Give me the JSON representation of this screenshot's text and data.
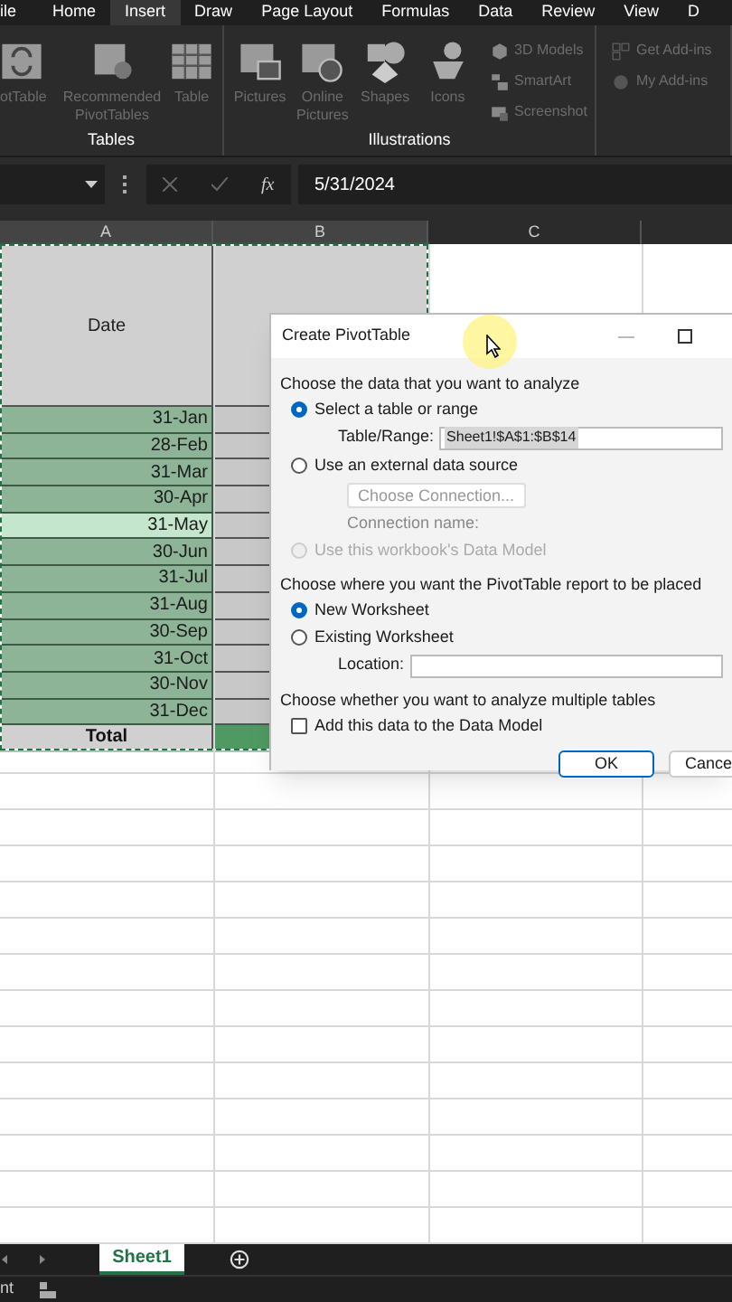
{
  "ribbon_tabs": [
    {
      "label": "ile",
      "selected": false
    },
    {
      "label": "Home",
      "selected": false
    },
    {
      "label": "Insert",
      "selected": true
    },
    {
      "label": "Draw",
      "selected": false
    },
    {
      "label": "Page Layout",
      "selected": false
    },
    {
      "label": "Formulas",
      "selected": false
    },
    {
      "label": "Data",
      "selected": false
    },
    {
      "label": "Review",
      "selected": false
    },
    {
      "label": "View",
      "selected": false
    },
    {
      "label": "D",
      "selected": false
    }
  ],
  "ribbon_groups": [
    {
      "label": "Tables",
      "commands": [
        {
          "label": "otTable",
          "kind": "pivot"
        },
        {
          "label": "Recommended PivotTables",
          "kind": "recommended"
        },
        {
          "label": "Table",
          "kind": "table"
        }
      ]
    },
    {
      "label": "Illustrations",
      "commands": [
        {
          "label": "Pictures",
          "kind": "pictures"
        },
        {
          "label": "Online Pictures",
          "kind": "online"
        },
        {
          "label": "Shapes",
          "kind": "shapes"
        },
        {
          "label": "Icons",
          "kind": "icons"
        },
        {
          "label": "3D Models",
          "kind": "models"
        },
        {
          "label": "SmartArt",
          "kind": "smartart"
        },
        {
          "label": "Screenshot",
          "kind": "screenshot"
        }
      ]
    },
    {
      "commands": [
        {
          "label": "Get Add-ins",
          "kind": "addins"
        },
        {
          "label": "My Add-ins",
          "kind": "myaddins"
        }
      ]
    }
  ],
  "formula_bar": {
    "formula": "5/31/2024",
    "fx": "fx"
  },
  "columns": [
    "A",
    "B",
    "C"
  ],
  "header_cell": "Date",
  "rows": [
    {
      "date": "31-Jan",
      "selected": false
    },
    {
      "date": "28-Feb",
      "selected": false
    },
    {
      "date": "31-Mar",
      "selected": false
    },
    {
      "date": "30-Apr",
      "selected": false
    },
    {
      "date": "31-May",
      "selected": true
    },
    {
      "date": "30-Jun",
      "selected": false
    },
    {
      "date": "31-Jul",
      "selected": false
    },
    {
      "date": "31-Aug",
      "selected": false
    },
    {
      "date": "30-Sep",
      "selected": false
    },
    {
      "date": "31-Oct",
      "selected": false
    },
    {
      "date": "30-Nov",
      "selected": false
    },
    {
      "date": "31-Dec",
      "selected": false
    }
  ],
  "total_label": "Total",
  "dialog": {
    "title": "Create PivotTable",
    "items": [
      {
        "kind": "heading",
        "label": "Choose the data that you want to analyze"
      },
      {
        "kind": "radio",
        "label": "Select a table or range",
        "selected": true,
        "disabled": false
      },
      {
        "kind": "field",
        "label": "Table/Range:",
        "value": "Sheet1!$A$1:$B$14"
      },
      {
        "kind": "radio",
        "label": "Use an external data source",
        "selected": false,
        "disabled": false
      },
      {
        "kind": "button",
        "label": "Choose Connection..."
      },
      {
        "kind": "note",
        "label": "Connection name:"
      },
      {
        "kind": "radio",
        "label": "Use this workbook's Data Model",
        "selected": false,
        "disabled": true
      },
      {
        "kind": "heading",
        "label": "Choose where you want the PivotTable report to be placed"
      },
      {
        "kind": "radio",
        "label": "New Worksheet",
        "selected": true,
        "disabled": false
      },
      {
        "kind": "radio",
        "label": "Existing Worksheet",
        "selected": false,
        "disabled": false
      },
      {
        "kind": "field",
        "label": "Location:"
      },
      {
        "kind": "heading",
        "label": "Choose whether you want to analyze multiple tables"
      },
      {
        "kind": "checkbox",
        "label": "Add this data to the Data Model",
        "checked": false
      }
    ],
    "buttons": [
      "OK",
      "Cance"
    ]
  },
  "sheet_tabs": [
    {
      "label": "Sheet1",
      "selected": true
    }
  ],
  "status_text": "nt"
}
